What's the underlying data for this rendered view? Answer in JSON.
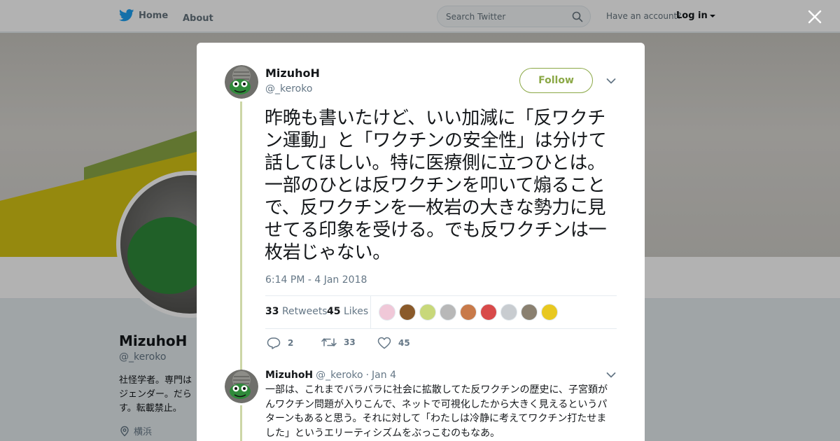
{
  "nav": {
    "home_label": "Home",
    "about_label": "About",
    "search_placeholder": "Search Twitter",
    "account_prompt": "Have an account?",
    "login_label": "Log in"
  },
  "profile": {
    "name": "MizuhoH",
    "handle": "@_keroko",
    "bio": "社怪学者。専門は\nジェンダー。だら\nす。転載禁止。",
    "location": "横浜"
  },
  "tweet": {
    "author_name": "MizuhoH",
    "author_handle": "@_keroko",
    "follow_label": "Follow",
    "text": "昨晩も書いたけど、いい加減に「反ワクチン運動」と「ワクチンの安全性」は分けて話してほしい。特に医療側に立つひとは。一部のひとは反ワクチンを叩いて煽ることで、反ワクチンを一枚岩の大きな勢力に見せてる印象を受ける。でも反ワクチンは一枚岩じゃない。",
    "timestamp": "6:14 PM - 4 Jan 2018",
    "retweets_count": "33",
    "retweets_label": "Retweets",
    "likes_count": "45",
    "likes_label": "Likes",
    "reply_count": "2",
    "retweet_action_count": "33",
    "like_action_count": "45"
  },
  "likers": [
    "#f0c8d8",
    "#8a5a2a",
    "#c8d87a",
    "#b8b8b8",
    "#c87a4a",
    "#d84a4a",
    "#c8ccd0",
    "#8a8070",
    "#e8c820"
  ],
  "reply": {
    "author_name": "MizuhoH",
    "author_handle": "@_keroko",
    "separator": "·",
    "date": "Jan 4",
    "text": "一部は、これまでバラバラに社会に拡散してた反ワクチンの歴史に、子宮頚がんワクチン問題が入りこんで、ネットで可視化したから大きく見えるというパターンもあると思う。それに対して「わたしは冷静に考えてワクチン打たせました」というエリーティシズムをぶっこむのもなあ。"
  },
  "colors": {
    "accent": "#8ba846",
    "twitter_blue": "#1da1f2",
    "text_primary": "#14171a",
    "text_secondary": "#657786"
  }
}
